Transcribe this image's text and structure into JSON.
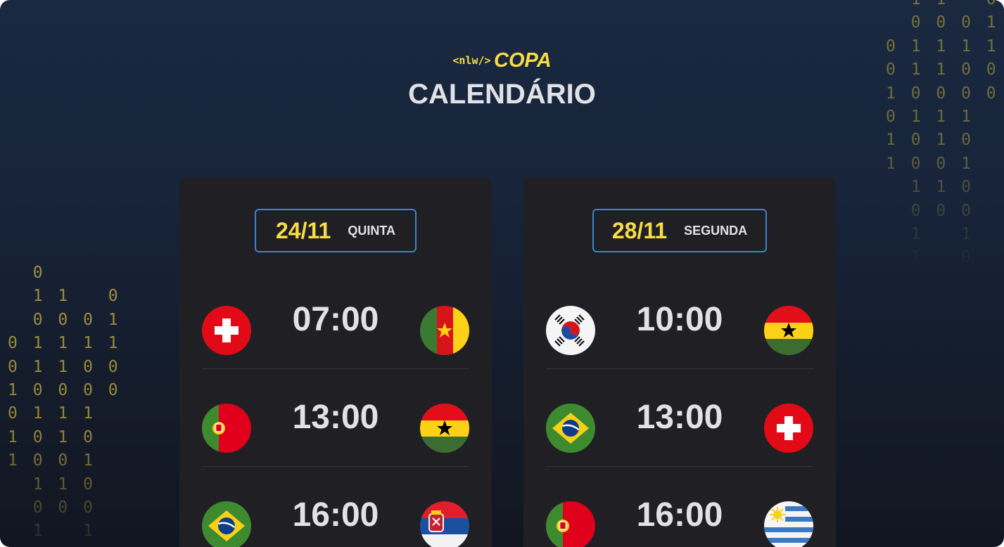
{
  "logo": {
    "tag": "<nlw/>",
    "word": "COPA"
  },
  "page_title": "CALENDÁRIO",
  "colors": {
    "accent": "#f7dd43",
    "border": "#3b82d6",
    "card": "#202024",
    "text": "#e1e1e6"
  },
  "decor": {
    "binary_left": "  0\n  1 1   0\n  0 0 0 1\n0 1 1 1 1\n0 1 1 0 0\n1 0 0 0 0\n0 1 1 1\n1 0 1 0\n1 0 0 1\n  1 1 0\n  0 0 0\n  1   1",
    "binary_right": "  1 1   0\n  0 0 0 1\n0 1 1 1 1\n0 1 1 0 0\n1 0 0 0 0\n0 1 1 1\n1 0 1 0\n1 0 0 1\n  1 1 0\n  0 0 0\n  1   1\n  1   0"
  },
  "days": [
    {
      "date": "24/11",
      "weekday": "QUINTA",
      "matches": [
        {
          "time": "07:00",
          "home": "switzerland-flag",
          "away": "cameroon-flag"
        },
        {
          "time": "13:00",
          "home": "portugal-flag",
          "away": "ghana-flag"
        },
        {
          "time": "16:00",
          "home": "brazil-flag",
          "away": "serbia-flag"
        }
      ]
    },
    {
      "date": "28/11",
      "weekday": "SEGUNDA",
      "matches": [
        {
          "time": "10:00",
          "home": "south-korea-flag",
          "away": "ghana-flag"
        },
        {
          "time": "13:00",
          "home": "brazil-flag",
          "away": "switzerland-flag"
        },
        {
          "time": "16:00",
          "home": "portugal-flag",
          "away": "uruguay-flag"
        }
      ]
    }
  ]
}
